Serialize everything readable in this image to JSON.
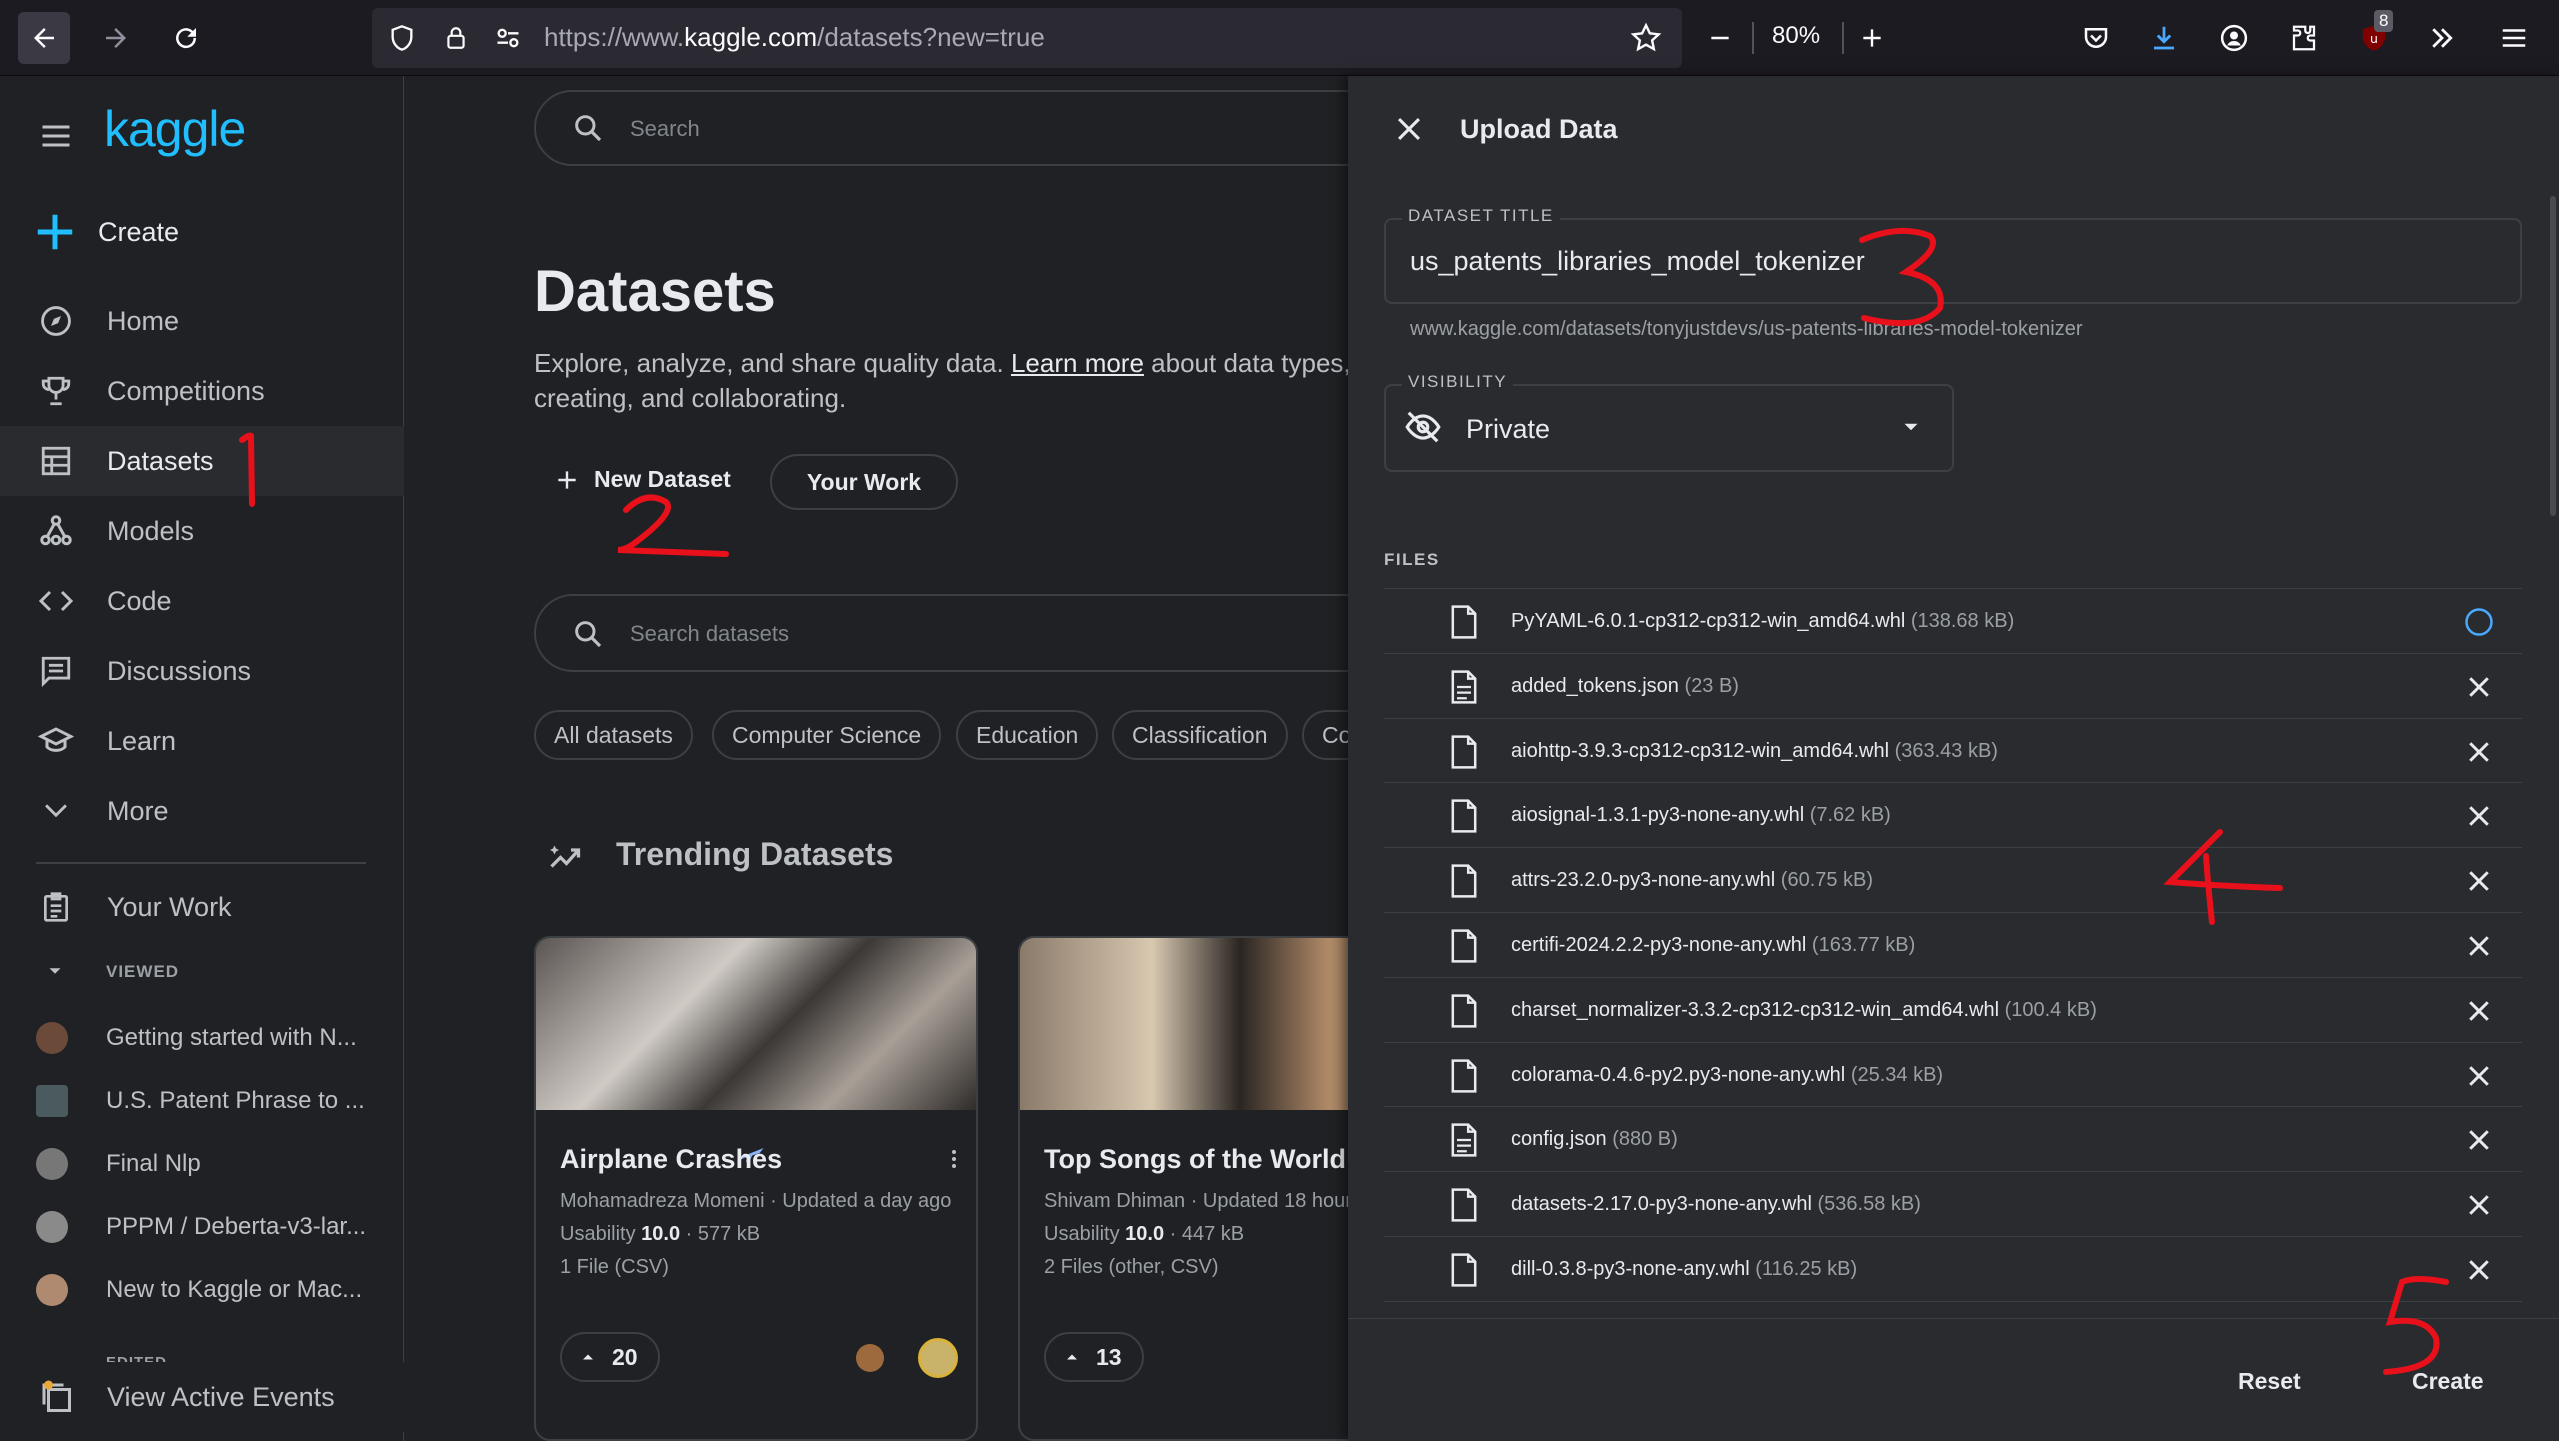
{
  "browser": {
    "url_prefix": "https://www.",
    "url_host": "kaggle.com",
    "url_path": "/datasets?new=true",
    "zoom": "80%",
    "extension_badge": "8"
  },
  "kaggle": {
    "logo": "kaggle",
    "create_label": "Create",
    "nav": [
      {
        "label": "Home",
        "icon": "compass-icon"
      },
      {
        "label": "Competitions",
        "icon": "trophy-icon"
      },
      {
        "label": "Datasets",
        "icon": "table-icon"
      },
      {
        "label": "Models",
        "icon": "models-icon"
      },
      {
        "label": "Code",
        "icon": "code-icon"
      },
      {
        "label": "Discussions",
        "icon": "discussions-icon"
      },
      {
        "label": "Learn",
        "icon": "learn-icon"
      },
      {
        "label": "More",
        "icon": "chevron-down-icon"
      }
    ],
    "your_work": "Your Work",
    "viewed_header": "VIEWED",
    "viewed": [
      "Getting started with N...",
      "U.S. Patent Phrase to ...",
      "Final Nlp",
      "PPPM / Deberta-v3-lar...",
      "New to Kaggle or Mac..."
    ],
    "edited_header": "EDITED",
    "view_active_events": "View Active Events"
  },
  "main": {
    "search_placeholder": "Search",
    "title": "Datasets",
    "desc_before": "Explore, analyze, and share quality data. ",
    "desc_link": "Learn more",
    "desc_after": " about data types, creating, and collaborating.",
    "new_dataset": "New Dataset",
    "your_work": "Your Work",
    "search_datasets_placeholder": "Search datasets",
    "chips": [
      "All datasets",
      "Computer Science",
      "Education",
      "Classification",
      "Co"
    ],
    "trending_title": "Trending Datasets",
    "cards": [
      {
        "title": "Airplane Crashes",
        "author": "Mohamadreza Momeni · Updated a day ago",
        "usability_label": "Usability ",
        "usability": "10.0",
        "size": " · 577 kB",
        "files": "1 File (CSV)",
        "votes": "20"
      },
      {
        "title": "Top Songs of the World",
        "author": "Shivam Dhiman · Updated 18 hour",
        "usability_label": "Usability ",
        "usability": "10.0",
        "size": " · 447 kB",
        "files": "2 Files (other, CSV)",
        "votes": "13"
      }
    ]
  },
  "upload": {
    "title": "Upload Data",
    "dataset_title_label": "DATASET TITLE",
    "dataset_title_value": "us_patents_libraries_model_tokenizer",
    "dataset_url": "www.kaggle.com/datasets/tonyjustdevs/us-patents-libraries-model-tokenizer",
    "visibility_label": "VISIBILITY",
    "visibility_value": "Private",
    "files_header": "FILES",
    "files": [
      {
        "name": "PyYAML-6.0.1-cp312-cp312-win_amd64.whl",
        "size": "(138.68 kB)",
        "status": "uploading"
      },
      {
        "name": "added_tokens.json",
        "size": "(23 B)",
        "status": "done"
      },
      {
        "name": "aiohttp-3.9.3-cp312-cp312-win_amd64.whl",
        "size": "(363.43 kB)",
        "status": "done"
      },
      {
        "name": "aiosignal-1.3.1-py3-none-any.whl",
        "size": "(7.62 kB)",
        "status": "done"
      },
      {
        "name": "attrs-23.2.0-py3-none-any.whl",
        "size": "(60.75 kB)",
        "status": "done"
      },
      {
        "name": "certifi-2024.2.2-py3-none-any.whl",
        "size": "(163.77 kB)",
        "status": "done"
      },
      {
        "name": "charset_normalizer-3.3.2-cp312-cp312-win_amd64.whl",
        "size": "(100.4 kB)",
        "status": "done"
      },
      {
        "name": "colorama-0.4.6-py2.py3-none-any.whl",
        "size": "(25.34 kB)",
        "status": "done"
      },
      {
        "name": "config.json",
        "size": "(880 B)",
        "status": "done"
      },
      {
        "name": "datasets-2.17.0-py3-none-any.whl",
        "size": "(536.58 kB)",
        "status": "done"
      },
      {
        "name": "dill-0.3.8-py3-none-any.whl",
        "size": "(116.25 kB)",
        "status": "done"
      }
    ],
    "reset_label": "Reset",
    "create_label": "Create"
  },
  "colors": {
    "kaggle_blue": "#20beff",
    "annotation_red": "#e8101a",
    "progress_blue": "#4aa8ff"
  }
}
